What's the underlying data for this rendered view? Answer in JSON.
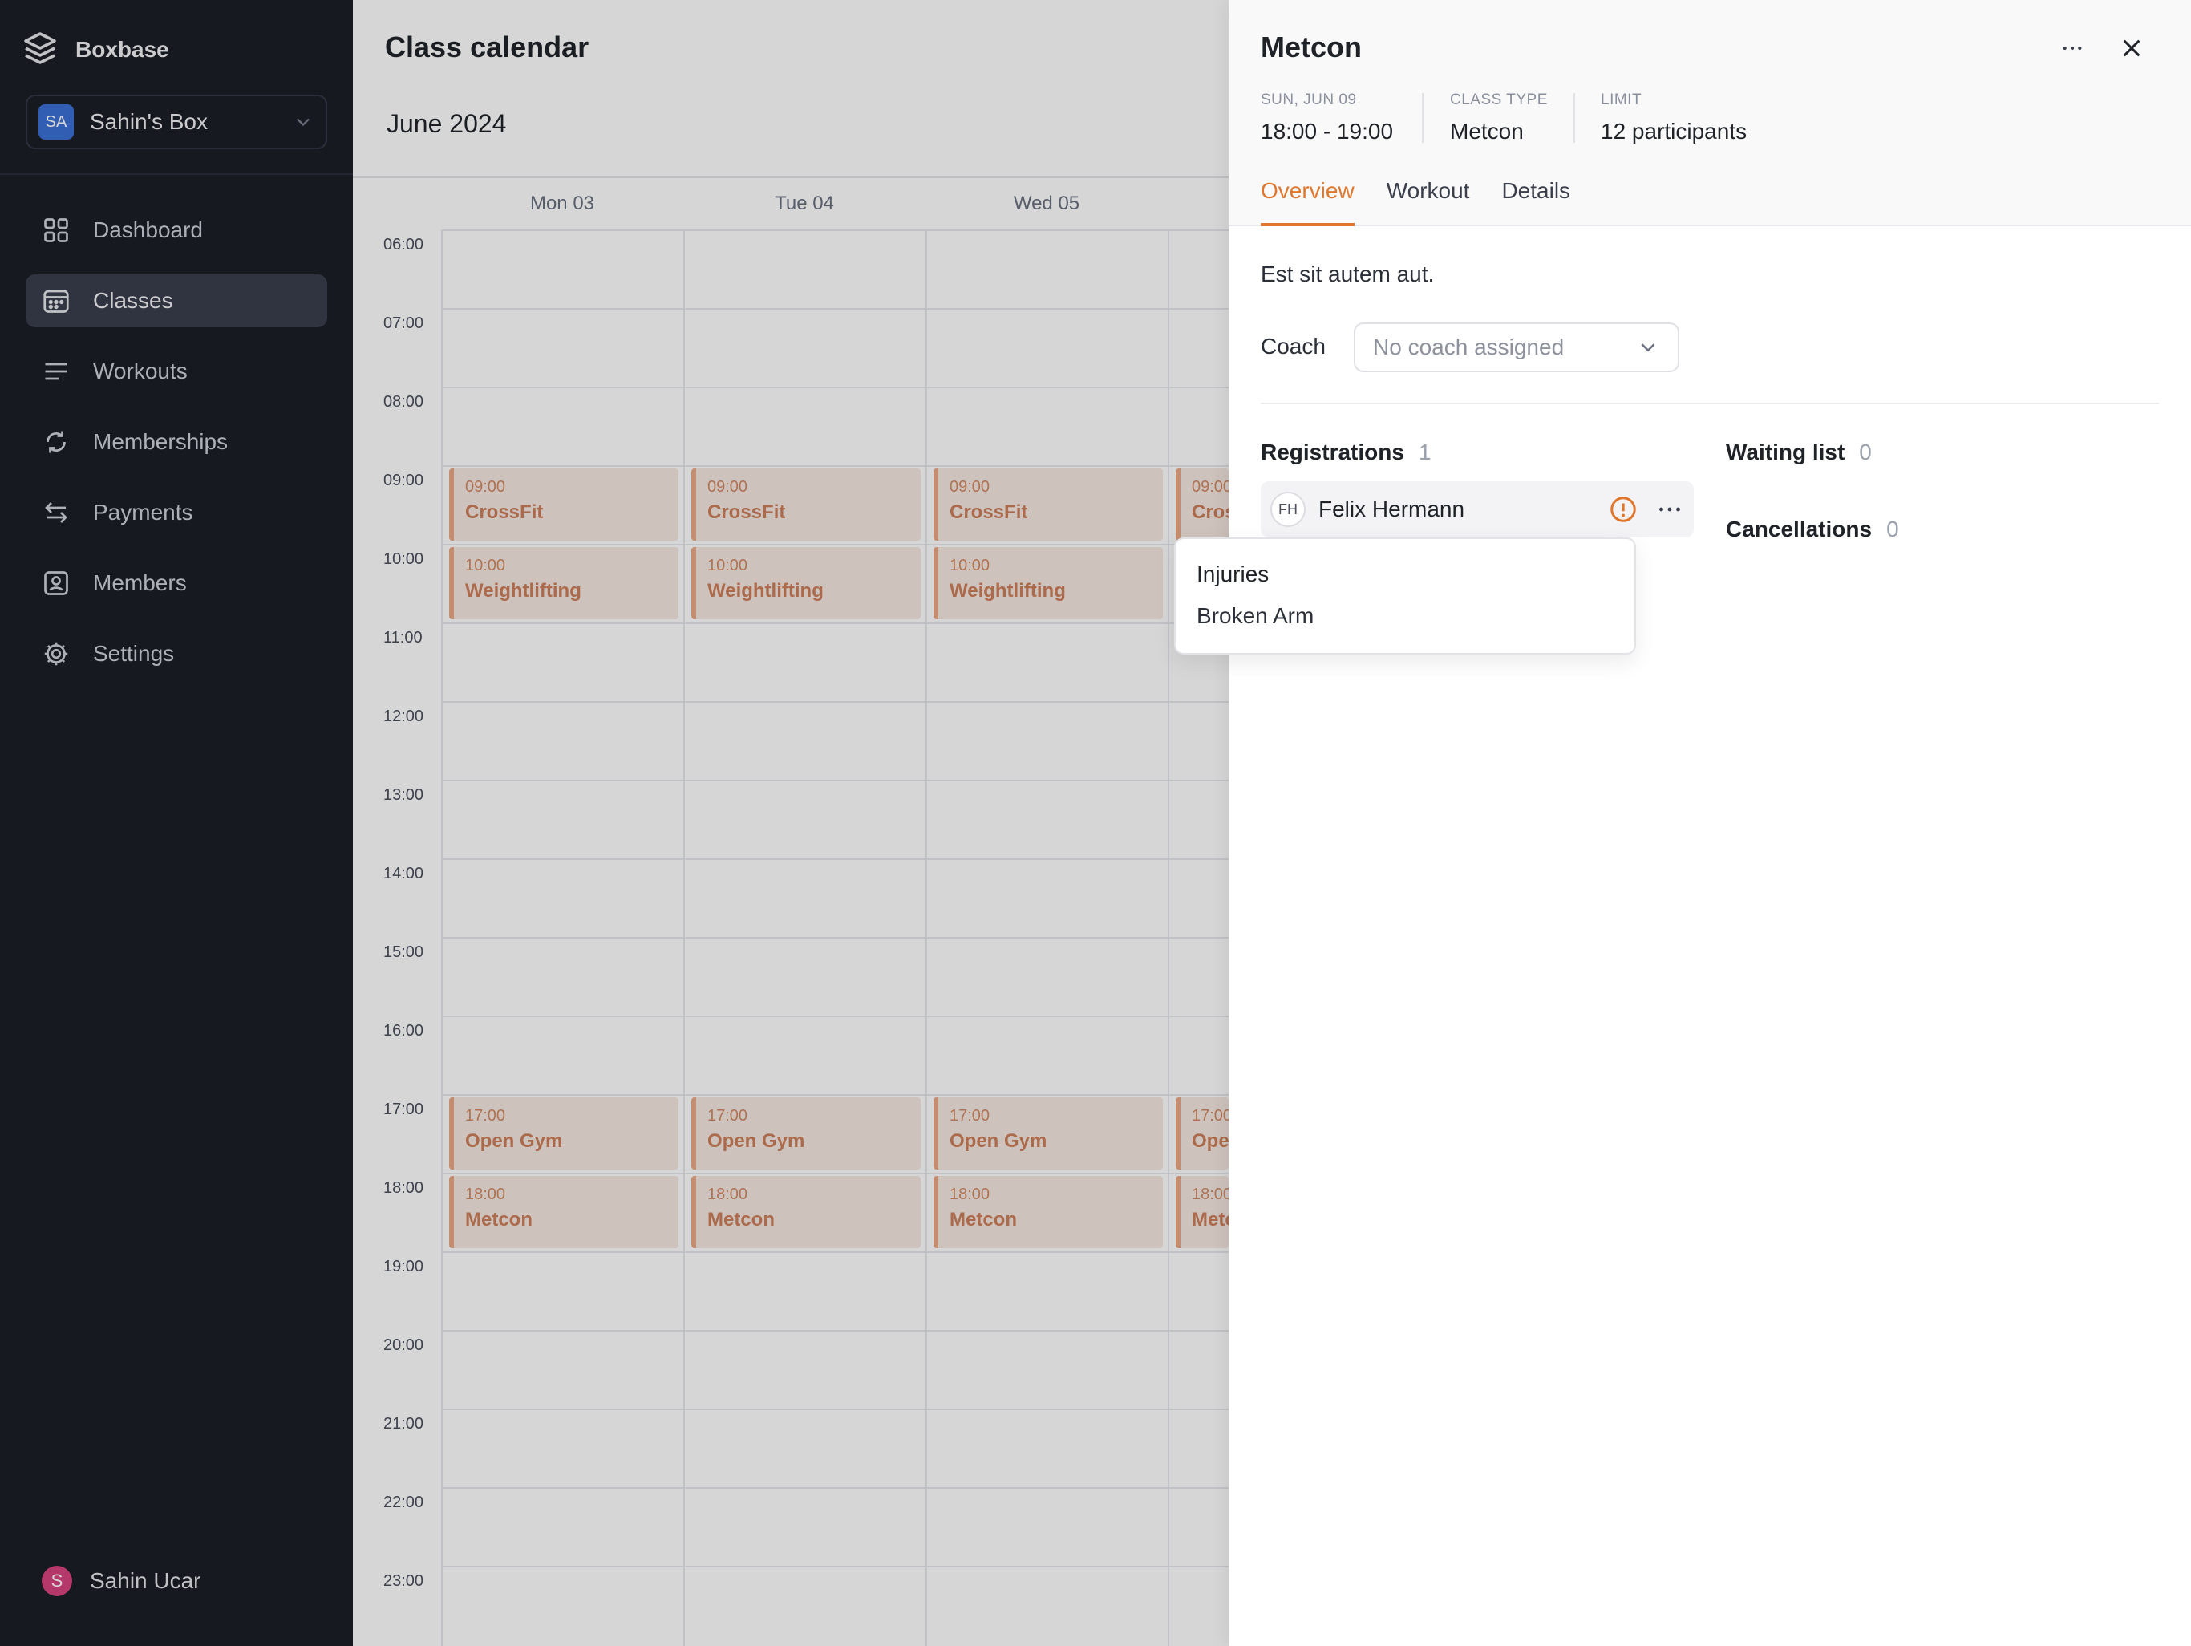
{
  "sidebar": {
    "brand": "Boxbase",
    "box": {
      "initials": "SA",
      "name": "Sahin's Box"
    },
    "nav": [
      {
        "label": "Dashboard",
        "icon": "grid-icon"
      },
      {
        "label": "Classes",
        "icon": "calendar-icon",
        "active": true
      },
      {
        "label": "Workouts",
        "icon": "list-icon"
      },
      {
        "label": "Memberships",
        "icon": "refresh-icon"
      },
      {
        "label": "Payments",
        "icon": "arrows-icon"
      },
      {
        "label": "Members",
        "icon": "user-card-icon"
      },
      {
        "label": "Settings",
        "icon": "gear-icon"
      }
    ],
    "user": {
      "initial": "S",
      "name": "Sahin Ucar"
    }
  },
  "calendar": {
    "title": "Class calendar",
    "month": "June 2024",
    "days": [
      "Mon 03",
      "Tue 04",
      "Wed 05"
    ],
    "hours": [
      "06:00",
      "07:00",
      "08:00",
      "09:00",
      "10:00",
      "11:00",
      "12:00",
      "13:00",
      "14:00",
      "15:00",
      "16:00",
      "17:00",
      "18:00",
      "19:00",
      "20:00",
      "21:00",
      "22:00",
      "23:00"
    ],
    "events": [
      {
        "day": 0,
        "time": "09:00",
        "name": "CrossFit"
      },
      {
        "day": 0,
        "time": "10:00",
        "name": "Weightlifting"
      },
      {
        "day": 0,
        "time": "17:00",
        "name": "Open Gym"
      },
      {
        "day": 0,
        "time": "18:00",
        "name": "Metcon"
      },
      {
        "day": 1,
        "time": "09:00",
        "name": "CrossFit"
      },
      {
        "day": 1,
        "time": "10:00",
        "name": "Weightlifting"
      },
      {
        "day": 1,
        "time": "17:00",
        "name": "Open Gym"
      },
      {
        "day": 1,
        "time": "18:00",
        "name": "Metcon"
      },
      {
        "day": 2,
        "time": "09:00",
        "name": "CrossFit"
      },
      {
        "day": 2,
        "time": "10:00",
        "name": "Weightlifting"
      },
      {
        "day": 2,
        "time": "17:00",
        "name": "Open Gym"
      },
      {
        "day": 2,
        "time": "18:00",
        "name": "Metcon"
      },
      {
        "day": 3,
        "time": "09:00",
        "name": "CrossFit"
      },
      {
        "day": 3,
        "time": "17:00",
        "name": "Open Gym"
      },
      {
        "day": 3,
        "time": "18:00",
        "name": "Metcon"
      }
    ]
  },
  "panel": {
    "title": "Metcon",
    "meta": [
      {
        "label": "SUN, JUN 09",
        "value": "18:00 - 19:00"
      },
      {
        "label": "CLASS TYPE",
        "value": "Metcon"
      },
      {
        "label": "LIMIT",
        "value": "12 participants"
      }
    ],
    "tabs": [
      "Overview",
      "Workout",
      "Details"
    ],
    "active_tab": "Overview",
    "description": "Est sit autem aut.",
    "coach_label": "Coach",
    "coach_placeholder": "No coach assigned",
    "registrations": {
      "label": "Registrations",
      "count": "1"
    },
    "waiting_list": {
      "label": "Waiting list",
      "count": "0"
    },
    "cancellations": {
      "label": "Cancellations",
      "count": "0"
    },
    "registrant": {
      "initials": "FH",
      "name": "Felix Hermann"
    },
    "popover": {
      "title": "Injuries",
      "items": [
        "Broken Arm"
      ]
    }
  },
  "colors": {
    "accent": "#e0772d",
    "sidebar_bg": "#1b1e27",
    "event_bg": "#f6e8e1",
    "event_border": "#eba885"
  }
}
